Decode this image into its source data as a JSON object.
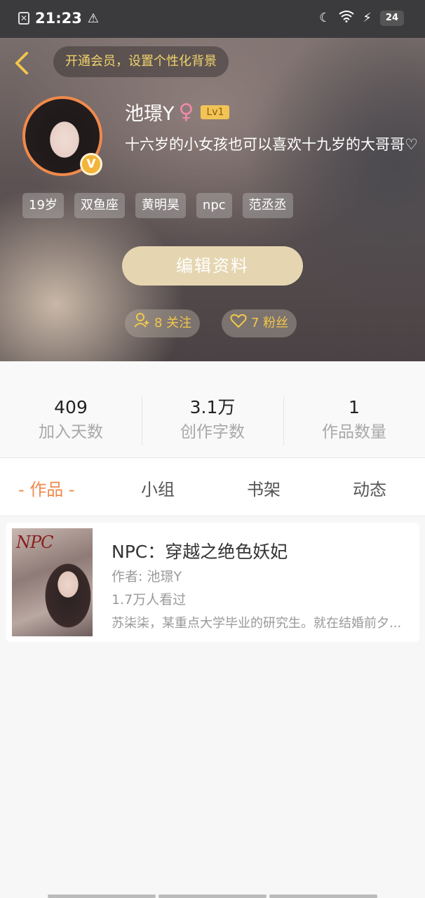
{
  "status_bar": {
    "time": "21:23",
    "battery": "24"
  },
  "header": {
    "vip_banner": "开通会员，设置个性化背景"
  },
  "profile": {
    "username": "池璟Y",
    "gender_symbol": "♀",
    "level": "Lv1",
    "verified_badge": "V",
    "bio": "十六岁的小女孩也可以喜欢十九岁的大哥哥♡",
    "tags": [
      "19岁",
      "双鱼座",
      "黄明昊",
      "npc",
      "范丞丞"
    ],
    "edit_button": "编辑资料",
    "following": "8 关注",
    "followers": "7 粉丝"
  },
  "stats": [
    {
      "value": "409",
      "label": "加入天数"
    },
    {
      "value": "3.1万",
      "label": "创作字数"
    },
    {
      "value": "1",
      "label": "作品数量"
    }
  ],
  "tabs": [
    "- 作品 -",
    "小组",
    "书架",
    "动态"
  ],
  "works": [
    {
      "cover_text": "NPC",
      "title": "NPC：穿越之绝色妖妃",
      "author": "作者: 池璟Y",
      "views": "1.7万人看过",
      "description": "苏柒柒，某重点大学毕业的研究生。就在结婚前夕..."
    }
  ],
  "colors": {
    "accent": "#ee8a4c",
    "gold": "#f2c74b",
    "edit_button": "#e5d6b1"
  }
}
